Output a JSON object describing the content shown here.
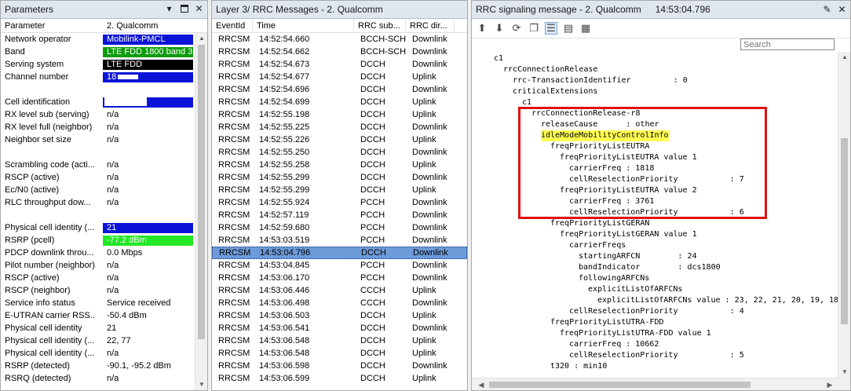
{
  "parameters": {
    "title": "Parameters",
    "header": {
      "name": "Parameter",
      "value": "2. Qualcomm"
    },
    "rows": [
      {
        "name": "Network operator",
        "value": "Mobilink-PMCL",
        "style": "blue"
      },
      {
        "name": "Band",
        "value": "LTE FDD 1800 band 3",
        "style": "green"
      },
      {
        "name": "Serving system",
        "value": "LTE FDD",
        "style": "black"
      },
      {
        "name": "Channel number",
        "value": "18",
        "style": "blue",
        "mask": "small"
      },
      {
        "name": "",
        "value": "",
        "style": ""
      },
      {
        "name": "Cell identification",
        "value": "",
        "style": "blue",
        "mask": "large"
      },
      {
        "name": "RX level sub (serving)",
        "value": "n/a",
        "style": ""
      },
      {
        "name": "RX level full (neighbor)",
        "value": "n/a",
        "style": ""
      },
      {
        "name": "Neighbor set size",
        "value": "n/a",
        "style": ""
      },
      {
        "name": "",
        "value": "",
        "style": ""
      },
      {
        "name": "Scrambling code (acti...",
        "value": "n/a",
        "style": ""
      },
      {
        "name": "RSCP (active)",
        "value": "n/a",
        "style": ""
      },
      {
        "name": "Ec/N0 (active)",
        "value": "n/a",
        "style": ""
      },
      {
        "name": "RLC throughput dow...",
        "value": "n/a",
        "style": ""
      },
      {
        "name": "",
        "value": "",
        "style": ""
      },
      {
        "name": "Physical cell identity (...",
        "value": "21",
        "style": "blue"
      },
      {
        "name": "RSRP (pcell)",
        "value": "-77.2 dBm",
        "style": "lime"
      },
      {
        "name": "PDCP downlink throu...",
        "value": "0.0 Mbps",
        "style": ""
      },
      {
        "name": "Pilot number (neighbor)",
        "value": "n/a",
        "style": ""
      },
      {
        "name": "RSCP (active)",
        "value": "n/a",
        "style": ""
      },
      {
        "name": "RSCP (neighbor)",
        "value": "n/a",
        "style": ""
      },
      {
        "name": "Service info status",
        "value": "Service received",
        "style": ""
      },
      {
        "name": "E-UTRAN carrier RSS...",
        "value": "-50.4 dBm",
        "style": ""
      },
      {
        "name": "Physical cell identity",
        "value": "21",
        "style": ""
      },
      {
        "name": "Physical cell identity (...",
        "value": "22, 77",
        "style": ""
      },
      {
        "name": "Physical cell identity (...",
        "value": "n/a",
        "style": ""
      },
      {
        "name": "RSRP (detected)",
        "value": "-90.1, -95.2 dBm",
        "style": ""
      },
      {
        "name": "RSRQ (detected)",
        "value": "n/a",
        "style": ""
      }
    ]
  },
  "messages": {
    "title": "Layer 3/ RRC Messages - 2. Qualcomm",
    "columns": [
      "EventId",
      "Time",
      "RRC sub...",
      "RRC dir..."
    ],
    "rows": [
      [
        "RRCSM",
        "14:52:54.660",
        "BCCH-SCH",
        "Downlink"
      ],
      [
        "RRCSM",
        "14:52:54.662",
        "BCCH-SCH",
        "Downlink"
      ],
      [
        "RRCSM",
        "14:52:54.673",
        "DCCH",
        "Downlink"
      ],
      [
        "RRCSM",
        "14:52:54.677",
        "DCCH",
        "Uplink"
      ],
      [
        "RRCSM",
        "14:52:54.696",
        "DCCH",
        "Downlink"
      ],
      [
        "RRCSM",
        "14:52:54.699",
        "DCCH",
        "Uplink"
      ],
      [
        "RRCSM",
        "14:52:55.198",
        "DCCH",
        "Uplink"
      ],
      [
        "RRCSM",
        "14:52:55.225",
        "DCCH",
        "Downlink"
      ],
      [
        "RRCSM",
        "14:52:55.226",
        "DCCH",
        "Uplink"
      ],
      [
        "RRCSM",
        "14:52:55.250",
        "DCCH",
        "Downlink"
      ],
      [
        "RRCSM",
        "14:52:55.258",
        "DCCH",
        "Uplink"
      ],
      [
        "RRCSM",
        "14:52:55.299",
        "DCCH",
        "Downlink"
      ],
      [
        "RRCSM",
        "14:52:55.299",
        "DCCH",
        "Uplink"
      ],
      [
        "RRCSM",
        "14:52:55.924",
        "PCCH",
        "Downlink"
      ],
      [
        "RRCSM",
        "14:52:57.119",
        "PCCH",
        "Downlink"
      ],
      [
        "RRCSM",
        "14:52:59.680",
        "PCCH",
        "Downlink"
      ],
      [
        "RRCSM",
        "14:53:03.519",
        "PCCH",
        "Downlink"
      ],
      [
        "RRCSM",
        "14:53:04.796",
        "DCCH",
        "Downlink"
      ],
      [
        "RRCSM",
        "14:53:04.845",
        "PCCH",
        "Downlink"
      ],
      [
        "RRCSM",
        "14:53:06.170",
        "PCCH",
        "Downlink"
      ],
      [
        "RRCSM",
        "14:53:06.446",
        "CCCH",
        "Uplink"
      ],
      [
        "RRCSM",
        "14:53:06.498",
        "CCCH",
        "Downlink"
      ],
      [
        "RRCSM",
        "14:53:06.503",
        "DCCH",
        "Uplink"
      ],
      [
        "RRCSM",
        "14:53:06.541",
        "DCCH",
        "Downlink"
      ],
      [
        "RRCSM",
        "14:53:06.548",
        "DCCH",
        "Uplink"
      ],
      [
        "RRCSM",
        "14:53:06.548",
        "DCCH",
        "Uplink"
      ],
      [
        "RRCSM",
        "14:53:06.598",
        "DCCH",
        "Downlink"
      ],
      [
        "RRCSM",
        "14:53:06.599",
        "DCCH",
        "Uplink"
      ]
    ],
    "selected_index": 17
  },
  "signaling": {
    "title": "RRC signaling message - 2. Qualcomm",
    "time": "14:53:04.796",
    "search_placeholder": "Search",
    "lines": [
      {
        "indent": 0,
        "text": "c1"
      },
      {
        "indent": 1,
        "text": "rrcConnectionRelease"
      },
      {
        "indent": 2,
        "text": "rrc-TransactionIdentifier         : 0"
      },
      {
        "indent": 2,
        "text": "criticalExtensions"
      },
      {
        "indent": 3,
        "text": "c1"
      },
      {
        "indent": 4,
        "text": "rrcConnectionRelease-r8"
      },
      {
        "indent": 5,
        "text": "releaseCause      : other"
      },
      {
        "indent": 5,
        "text": "idleModeMobilityControlInfo",
        "highlight": true
      },
      {
        "indent": 6,
        "text": "freqPriorityListEUTRA"
      },
      {
        "indent": 7,
        "text": "freqPriorityListEUTRA value 1"
      },
      {
        "indent": 8,
        "text": "carrierFreq : 1818"
      },
      {
        "indent": 8,
        "text": "cellReselectionPriority           : 7"
      },
      {
        "indent": 7,
        "text": "freqPriorityListEUTRA value 2"
      },
      {
        "indent": 8,
        "text": "carrierFreq : 3761"
      },
      {
        "indent": 8,
        "text": "cellReselectionPriority           : 6"
      },
      {
        "indent": 6,
        "text": "freqPriorityListGERAN"
      },
      {
        "indent": 7,
        "text": "freqPriorityListGERAN value 1"
      },
      {
        "indent": 8,
        "text": "carrierFreqs"
      },
      {
        "indent": 9,
        "text": "startingARFCN        : 24"
      },
      {
        "indent": 9,
        "text": "bandIndicator        : dcs1800"
      },
      {
        "indent": 9,
        "text": "followingARFCNs"
      },
      {
        "indent": 10,
        "text": "explicitListOfARFCNs"
      },
      {
        "indent": 11,
        "text": "explicitListOfARFCNs value : 23, 22, 21, 20, 19, 18"
      },
      {
        "indent": 8,
        "text": "cellReselectionPriority           : 4"
      },
      {
        "indent": 6,
        "text": "freqPriorityListUTRA-FDD"
      },
      {
        "indent": 7,
        "text": "freqPriorityListUTRA-FDD value 1"
      },
      {
        "indent": 8,
        "text": "carrierFreq : 10662"
      },
      {
        "indent": 8,
        "text": "cellReselectionPriority           : 5"
      },
      {
        "indent": 6,
        "text": "t320 : min10"
      }
    ]
  }
}
